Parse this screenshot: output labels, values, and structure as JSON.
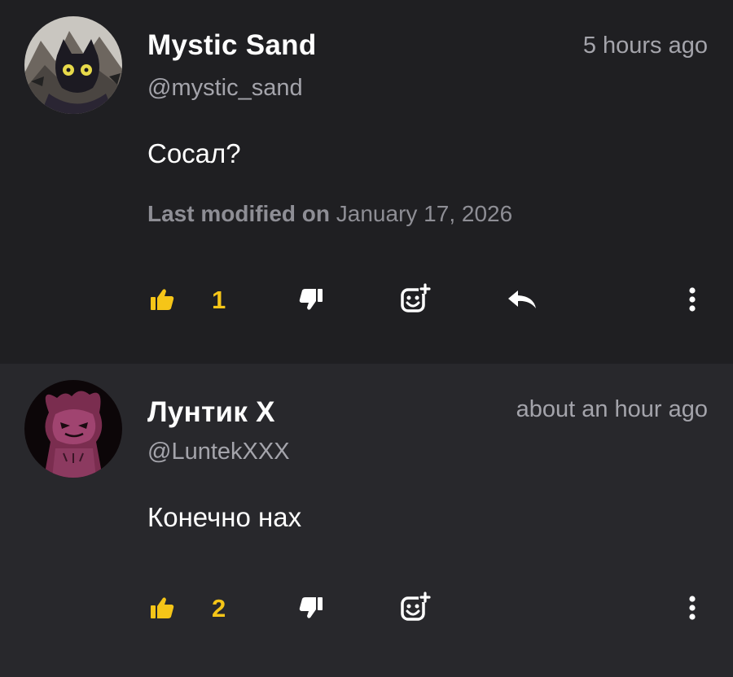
{
  "comments": [
    {
      "name": "Mystic Sand",
      "handle": "@mystic_sand",
      "time": "5 hours ago",
      "text": "Сосал?",
      "modified_label": "Last modified on",
      "modified_date": "January 17, 2026",
      "likes": "1",
      "avatar_icon": "cat-avatar-icon"
    },
    {
      "name": "Лунтик X",
      "handle": "@LuntekXXX",
      "time": "about an hour ago",
      "text": "Конечно нах",
      "likes": "2",
      "avatar_icon": "pink-creature-avatar-icon"
    }
  ],
  "colors": {
    "background_first": "#1f1f22",
    "background_second": "#28282c",
    "name": "#ffffff",
    "muted": "#a4a4ab",
    "like_accent": "#f5c518"
  }
}
